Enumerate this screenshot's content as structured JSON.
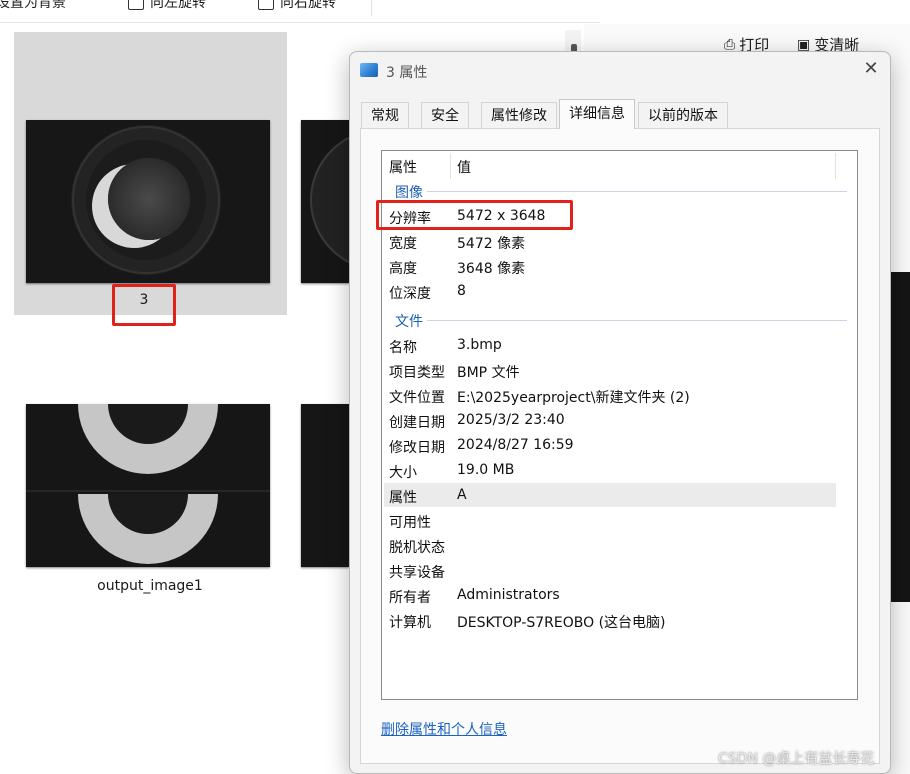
{
  "explorer": {
    "toolbar": [
      {
        "label": "设置为背景"
      },
      {
        "label": "向左旋转"
      },
      {
        "label": "向右旋转"
      }
    ],
    "right_toolbar": {
      "print_label": "打印",
      "sharpen_label": "变清晰"
    },
    "files": [
      {
        "name": "3",
        "selected": true
      },
      {
        "name": "output_image1",
        "selected": false
      }
    ]
  },
  "dialog": {
    "title": "3 属性",
    "close_label": "✕",
    "tabs": [
      {
        "label": "常规",
        "active": false
      },
      {
        "label": "安全",
        "active": false
      },
      {
        "label": "属性修改",
        "active": false
      },
      {
        "label": "详细信息",
        "active": true
      },
      {
        "label": "以前的版本",
        "active": false
      }
    ],
    "details": {
      "headers": {
        "property": "属性",
        "value": "值"
      },
      "groups": [
        {
          "name": "图像",
          "rows": [
            {
              "name": "分辨率",
              "value": "5472 x 3648"
            },
            {
              "name": "宽度",
              "value": "5472 像素"
            },
            {
              "name": "高度",
              "value": "3648 像素"
            },
            {
              "name": "位深度",
              "value": "8"
            }
          ]
        },
        {
          "name": "文件",
          "rows": [
            {
              "name": "名称",
              "value": "3.bmp"
            },
            {
              "name": "项目类型",
              "value": "BMP 文件"
            },
            {
              "name": "文件位置",
              "value": "E:\\2025yearproject\\新建文件夹 (2)"
            },
            {
              "name": "创建日期",
              "value": "2025/3/2 23:40"
            },
            {
              "name": "修改日期",
              "value": "2024/8/27 16:59"
            },
            {
              "name": "大小",
              "value": "19.0 MB"
            },
            {
              "name": "属性",
              "value": "A"
            },
            {
              "name": "可用性",
              "value": ""
            },
            {
              "name": "脱机状态",
              "value": ""
            },
            {
              "name": "共享设备",
              "value": ""
            },
            {
              "name": "所有者",
              "value": "Administrators"
            },
            {
              "name": "计算机",
              "value": "DESKTOP-S7REOBO (这台电脑)"
            }
          ]
        }
      ]
    },
    "remove_link": "删除属性和个人信息"
  },
  "watermark": "CSDN @桌上有盆长寿花",
  "colors": {
    "highlight": "#e0221b",
    "link": "#1c62bf",
    "group_heading": "#1f5fb4"
  }
}
